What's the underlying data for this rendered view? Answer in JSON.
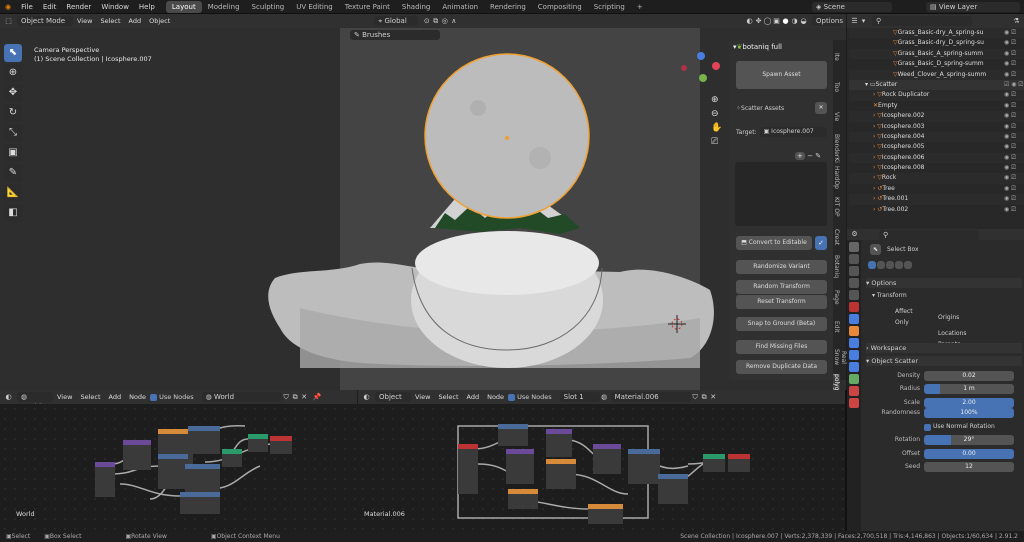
{
  "topbar": {
    "menus": [
      "File",
      "Edit",
      "Render",
      "Window",
      "Help"
    ],
    "workspaces": [
      "Layout",
      "Modeling",
      "Sculpting",
      "UV Editing",
      "Texture Paint",
      "Shading",
      "Animation",
      "Rendering",
      "Compositing",
      "Scripting"
    ],
    "active_workspace": "Layout",
    "scene": "Scene",
    "view_layer": "View Layer"
  },
  "viewport_header": {
    "mode": "Object Mode",
    "menus": [
      "View",
      "Select",
      "Add",
      "Object"
    ],
    "orientation": "Global",
    "options": "Options",
    "brushes": "Brushes"
  },
  "viewport": {
    "camera_label": "Camera Perspective",
    "collection_label": "(1) Scene Collection | Icosphere.007"
  },
  "npanel": {
    "title": "botaniq full",
    "spawn": "Spawn Asset",
    "scatter_assets": "Scatter Assets",
    "target_label": "Target:",
    "target_value": "Icosphere.007",
    "convert": "Convert to Editable",
    "randomize": "Randomize Variant",
    "random_transform": "Random Transform",
    "reset_transform": "Reset Transform",
    "snap_ground": "Snap to Ground (Beta)",
    "find_missing": "Find Missing Files",
    "remove_dup": "Remove Duplicate Data",
    "tabs": [
      "Ite",
      "Too",
      "Vie",
      "BlenderKi",
      "HardOp",
      "KIT OP",
      "Creat",
      "Botaniq",
      "Page",
      "Edit",
      "Real Snow",
      "polygoniq"
    ]
  },
  "outliner": {
    "rows": [
      "Grass_Basic-dry_A_spring-su",
      "Grass_Basic-dry_D_spring-su",
      "Grass_Basic_A_spring-summ",
      "Grass_Basic_D_spring-summ",
      "Weed_Clover_A_spring-summ",
      "Scatter",
      "Rock Duplicator",
      "Empty",
      "Icosphere.002",
      "Icosphere.003",
      "Icosphere.004",
      "Icosphere.005",
      "Icosphere.006",
      "Icosphere.008",
      "Rock",
      "Tree",
      "Tree.001",
      "Tree.002"
    ]
  },
  "properties": {
    "tool": "Select Box",
    "options": "Options",
    "transform": "Transform",
    "affect_only": "Affect Only",
    "origins": "Origins",
    "locations": "Locations",
    "parents": "Parents",
    "workspace": "Workspace",
    "object_scatter": "Object Scatter",
    "density_label": "Density",
    "density": "0.02",
    "radius_label": "Radius",
    "radius": "1 m",
    "scale_label": "Scale",
    "scale": "2.00",
    "randomness_label": "Randomness",
    "randomness": "100%",
    "normal_rot": "Use Normal Rotation",
    "rotation_label": "Rotation",
    "rotation": "29°",
    "offset_label": "Offset",
    "offset": "0.00",
    "seed_label": "Seed",
    "seed": "12"
  },
  "node_left": {
    "type": "World",
    "menus": [
      "View",
      "Select",
      "Add",
      "Node"
    ],
    "use_nodes": "Use Nodes",
    "world": "World",
    "corner": "World"
  },
  "node_right": {
    "type": "Object",
    "menus": [
      "View",
      "Select",
      "Add",
      "Node"
    ],
    "use_nodes": "Use Nodes",
    "slot": "Slot 1",
    "material": "Material.006",
    "corner": "Material.006"
  },
  "statusbar": {
    "select": "Select",
    "box_select": "Box Select",
    "rotate": "Rotate View",
    "context": "Object Context Menu",
    "stats": "Scene Collection | Icosphere.007 | Verts:2,378,339 | Faces:2,700,518 | Tris:4,146,863 | Objects:1/60,634 | 2.91.2"
  },
  "colors": {
    "accent": "#4772b3",
    "selection": "#f0a030",
    "bg": "#3d3d3d"
  }
}
